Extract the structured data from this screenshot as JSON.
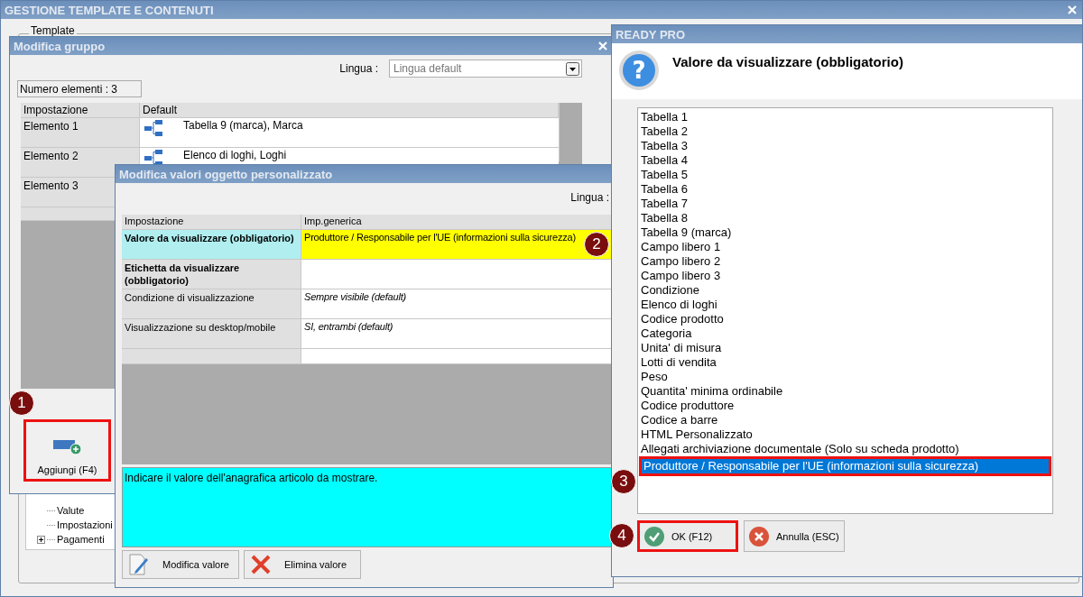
{
  "main_window": {
    "title": "GESTIONE TEMPLATE E CONTENUTI",
    "group_label": "Template",
    "tree_items": [
      {
        "label": "Valute",
        "expandable": false
      },
      {
        "label": "Impostazioni",
        "expandable": false
      },
      {
        "label": "Pagamenti",
        "expandable": true
      }
    ]
  },
  "group_window": {
    "title": "Modifica gruppo",
    "language_label": "Lingua :",
    "language_value": "Lingua default",
    "count": "Numero elementi : 3",
    "table": {
      "columns": [
        "Impostazione",
        "Default"
      ],
      "rows": [
        {
          "name": "Elemento 1",
          "value": "Tabella 9 (marca), Marca"
        },
        {
          "name": "Elemento 2",
          "value": "Elenco di loghi, Loghi"
        },
        {
          "name": "Elemento 3"
        }
      ]
    },
    "add_button": {
      "label": "Aggiungi (F4)",
      "highlighted": true
    }
  },
  "values_window": {
    "title": "Modifica valori oggetto personalizzato",
    "language_label": "Lingua :",
    "table": {
      "columns": [
        "Impostazione",
        "Imp.generica"
      ],
      "rows": [
        {
          "setting": "Valore da visualizzare (obbligatorio)",
          "value": "Produttore / Responsabile per l'UE (informazioni sulla sicurezza)",
          "required": true,
          "default": false,
          "selected": true
        },
        {
          "setting": "Etichetta da visualizzare (obbligatorio)",
          "required": true,
          "default": false,
          "selected": false
        },
        {
          "setting": "Condizione di visualizzazione",
          "value": "Sempre visibile (default)",
          "required": false,
          "default": true,
          "selected": false
        },
        {
          "setting": "Visualizzazione su desktop/mobile",
          "value": "SI, entrambi (default)",
          "required": false,
          "default": true,
          "selected": false
        }
      ]
    },
    "description": "Indicare il valore dell'anagrafica articolo da mostrare.",
    "buttons": [
      {
        "label": "Modifica valore",
        "kind": "edit"
      },
      {
        "label": "Elimina valore",
        "kind": "delete"
      }
    ]
  },
  "dialog": {
    "title": "READY PRO",
    "icon": "?",
    "heading": "Valore da visualizzare (obbligatorio)",
    "options": [
      {
        "label": "Tabella 1",
        "selected": false
      },
      {
        "label": "Tabella 2",
        "selected": false
      },
      {
        "label": "Tabella 3",
        "selected": false
      },
      {
        "label": "Tabella 4",
        "selected": false
      },
      {
        "label": "Tabella 5",
        "selected": false
      },
      {
        "label": "Tabella 6",
        "selected": false
      },
      {
        "label": "Tabella 7",
        "selected": false
      },
      {
        "label": "Tabella 8",
        "selected": false
      },
      {
        "label": "Tabella 9 (marca)",
        "selected": false
      },
      {
        "label": "Campo libero 1",
        "selected": false
      },
      {
        "label": "Campo libero 2",
        "selected": false
      },
      {
        "label": "Campo libero 3",
        "selected": false
      },
      {
        "label": "Condizione",
        "selected": false
      },
      {
        "label": "Elenco di loghi",
        "selected": false
      },
      {
        "label": "Codice prodotto",
        "selected": false
      },
      {
        "label": "Categoria",
        "selected": false
      },
      {
        "label": "Unita' di misura",
        "selected": false
      },
      {
        "label": "Lotti di vendita",
        "selected": false
      },
      {
        "label": "Peso",
        "selected": false
      },
      {
        "label": "Quantita' minima ordinabile",
        "selected": false
      },
      {
        "label": "Codice produttore",
        "selected": false
      },
      {
        "label": "Codice a barre",
        "selected": false
      },
      {
        "label": "HTML Personalizzato",
        "selected": false
      },
      {
        "label": "Allegati archiviazione documentale (Solo su scheda prodotto)",
        "selected": false
      },
      {
        "label": "Produttore / Responsabile per l'UE (informazioni sulla sicurezza)",
        "selected": true,
        "highlighted": true
      }
    ],
    "buttons": [
      {
        "label": "OK (F12)",
        "kind": "ok",
        "highlighted": true
      },
      {
        "label": "Annulla (ESC)",
        "kind": "cancel",
        "highlighted": false
      }
    ]
  },
  "callouts": [
    "1",
    "2",
    "3",
    "4"
  ]
}
